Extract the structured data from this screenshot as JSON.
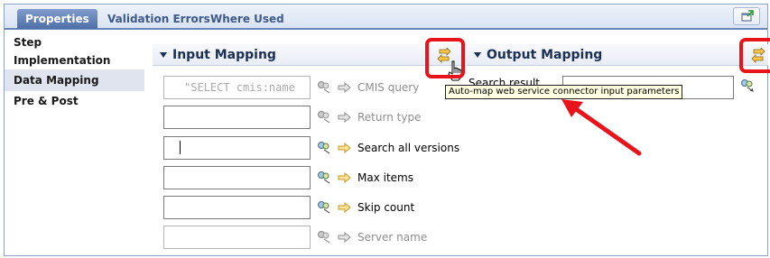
{
  "tabs": [
    {
      "label": "Properties"
    },
    {
      "label": "Validation Errors"
    },
    {
      "label": "Where Used"
    }
  ],
  "sidebar": {
    "items": [
      {
        "label": "Step"
      },
      {
        "label": "Implementation"
      },
      {
        "label": "Data Mapping",
        "selected": true
      },
      {
        "label": "Pre & Post"
      }
    ]
  },
  "input_mapping": {
    "title": "Input Mapping",
    "rows": [
      {
        "value": "\"SELECT cmis:name",
        "label": "CMIS query",
        "enabled": false
      },
      {
        "value": "",
        "label": "Return type",
        "enabled": false
      },
      {
        "value": "",
        "label": "Search all versions",
        "enabled": true
      },
      {
        "value": "",
        "label": "Max items",
        "enabled": true
      },
      {
        "value": "",
        "label": "Skip count",
        "enabled": true
      },
      {
        "value": "",
        "label": "Server name",
        "enabled": false
      }
    ]
  },
  "output_mapping": {
    "title": "Output Mapping",
    "row_label_fragment": "Search result"
  },
  "tooltip": {
    "text": "Auto-map web service connector input parameters"
  },
  "colors": {
    "highlight": "#e8141b",
    "tab_active": "#4f6fa8",
    "tooltip_bg": "#ffffe1",
    "selected_sidebar": "#dfe4ef"
  }
}
